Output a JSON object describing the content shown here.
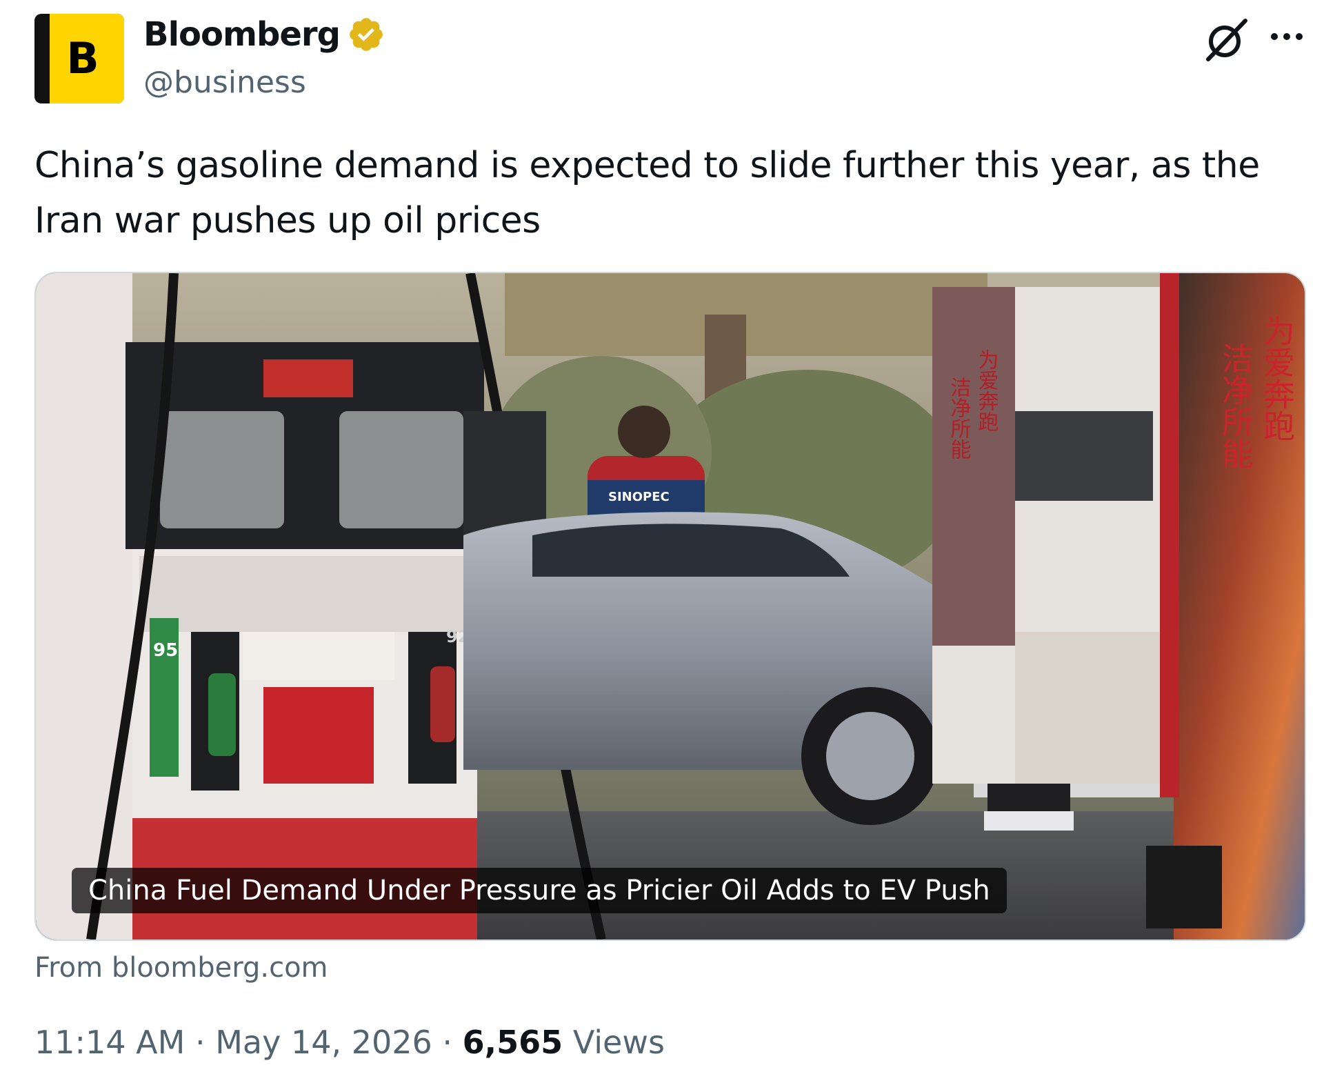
{
  "author": {
    "avatar_letter": "B",
    "name": "Bloomberg",
    "handle": "@business",
    "verified_color": "#e2b719"
  },
  "tweet": {
    "text": "China’s gasoline demand is expected to slide further this year, as the Iran war pushes up oil prices"
  },
  "card": {
    "title": "China Fuel Demand Under Pressure as Pricier Oil Adds to EV Push",
    "source": "From bloomberg.com",
    "photo_signage": {
      "worker_jacket": "SINOPEC",
      "pump_left_grade": "95",
      "pump_right_grade": "92",
      "banner_left_line1": "为爱奔跑",
      "banner_left_line2": "洁净所能",
      "banner_right_line1": "为爱奔跑",
      "banner_right_line2": "洁净所能"
    }
  },
  "meta": {
    "time": "11:14 AM",
    "separator": "·",
    "date": "May 14, 2026",
    "views_count": "6,565",
    "views_label": "Views"
  },
  "icons": [
    "verified-badge-icon",
    "grok-icon",
    "more-icon"
  ]
}
